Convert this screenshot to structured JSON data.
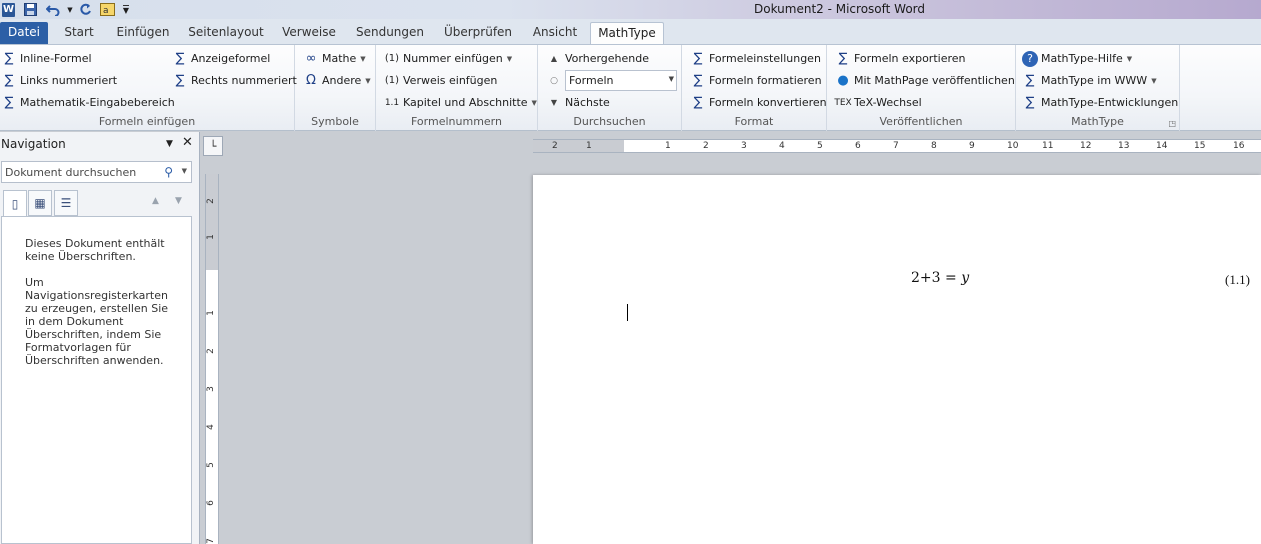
{
  "window": {
    "title": "Dokument2  -  Microsoft Word",
    "app_icon": "W"
  },
  "quick_access": [
    {
      "name": "save-icon"
    },
    {
      "name": "undo-icon"
    },
    {
      "name": "redo-icon"
    },
    {
      "name": "mathtype-quick-icon"
    },
    {
      "name": "customize-qat-icon"
    }
  ],
  "tabs": [
    "Datei",
    "Start",
    "Einfügen",
    "Seitenlayout",
    "Verweise",
    "Sendungen",
    "Überprüfen",
    "Ansicht",
    "MathType"
  ],
  "active_tab": "MathType",
  "ribbon": {
    "formeln_einfuegen": {
      "label": "Formeln einfügen",
      "inline": "Inline-Formel",
      "links": "Links nummeriert",
      "mathe_bereich": "Mathematik-Eingabebereich",
      "anzeige": "Anzeigeformel",
      "rechts": "Rechts nummeriert"
    },
    "symbole": {
      "label": "Symbole",
      "mathe": "Mathe",
      "andere": "Andere"
    },
    "formelnummern": {
      "label": "Formelnummern",
      "nummer": "Nummer einfügen",
      "verweis": "Verweis einfügen",
      "kapitel": "Kapitel und Abschnitte"
    },
    "durchsuchen": {
      "label": "Durchsuchen",
      "vorherige": "Vorhergehende",
      "combo_value": "Formeln",
      "naechste": "Nächste"
    },
    "format": {
      "label": "Format",
      "einstellungen": "Formeleinstellungen",
      "formatieren": "Formeln formatieren",
      "konvertieren": "Formeln konvertieren"
    },
    "veroeffentlichen": {
      "label": "Veröffentlichen",
      "exportieren": "Formeln exportieren",
      "mathpage": "Mit MathPage veröffentlichen",
      "tex": "TeX-Wechsel"
    },
    "mathtype": {
      "label": "MathType",
      "hilfe": "MathType-Hilfe",
      "www": "MathType im WWW",
      "entwicklungen": "MathType-Entwicklungen"
    }
  },
  "navigation": {
    "title": "Navigation",
    "search_placeholder": "Dokument durchsuchen",
    "message1": "Dieses Dokument enthält keine Überschriften.",
    "message2": "Um Navigationsregisterkarten zu erzeugen, erstellen Sie in dem Dokument Überschriften, indem Sie Formatvorlagen für Überschriften anwenden."
  },
  "ruler": {
    "h_numbers": [
      "2",
      "1",
      "1",
      "2",
      "3",
      "4",
      "5",
      "6",
      "7",
      "8",
      "9",
      "10",
      "11",
      "12",
      "13",
      "14",
      "15",
      "16"
    ],
    "v_numbers": [
      "2",
      "1",
      "1",
      "2",
      "3",
      "4",
      "5",
      "6",
      "7"
    ]
  },
  "document": {
    "equation": {
      "a": "2",
      "op1": "+",
      "b": "3",
      "op2": "=",
      "var": "y"
    },
    "equation_number": "(1.1)"
  },
  "colors": {
    "file_tab": "#2c5fa6",
    "ribbon_icon": "#1e3f86"
  }
}
